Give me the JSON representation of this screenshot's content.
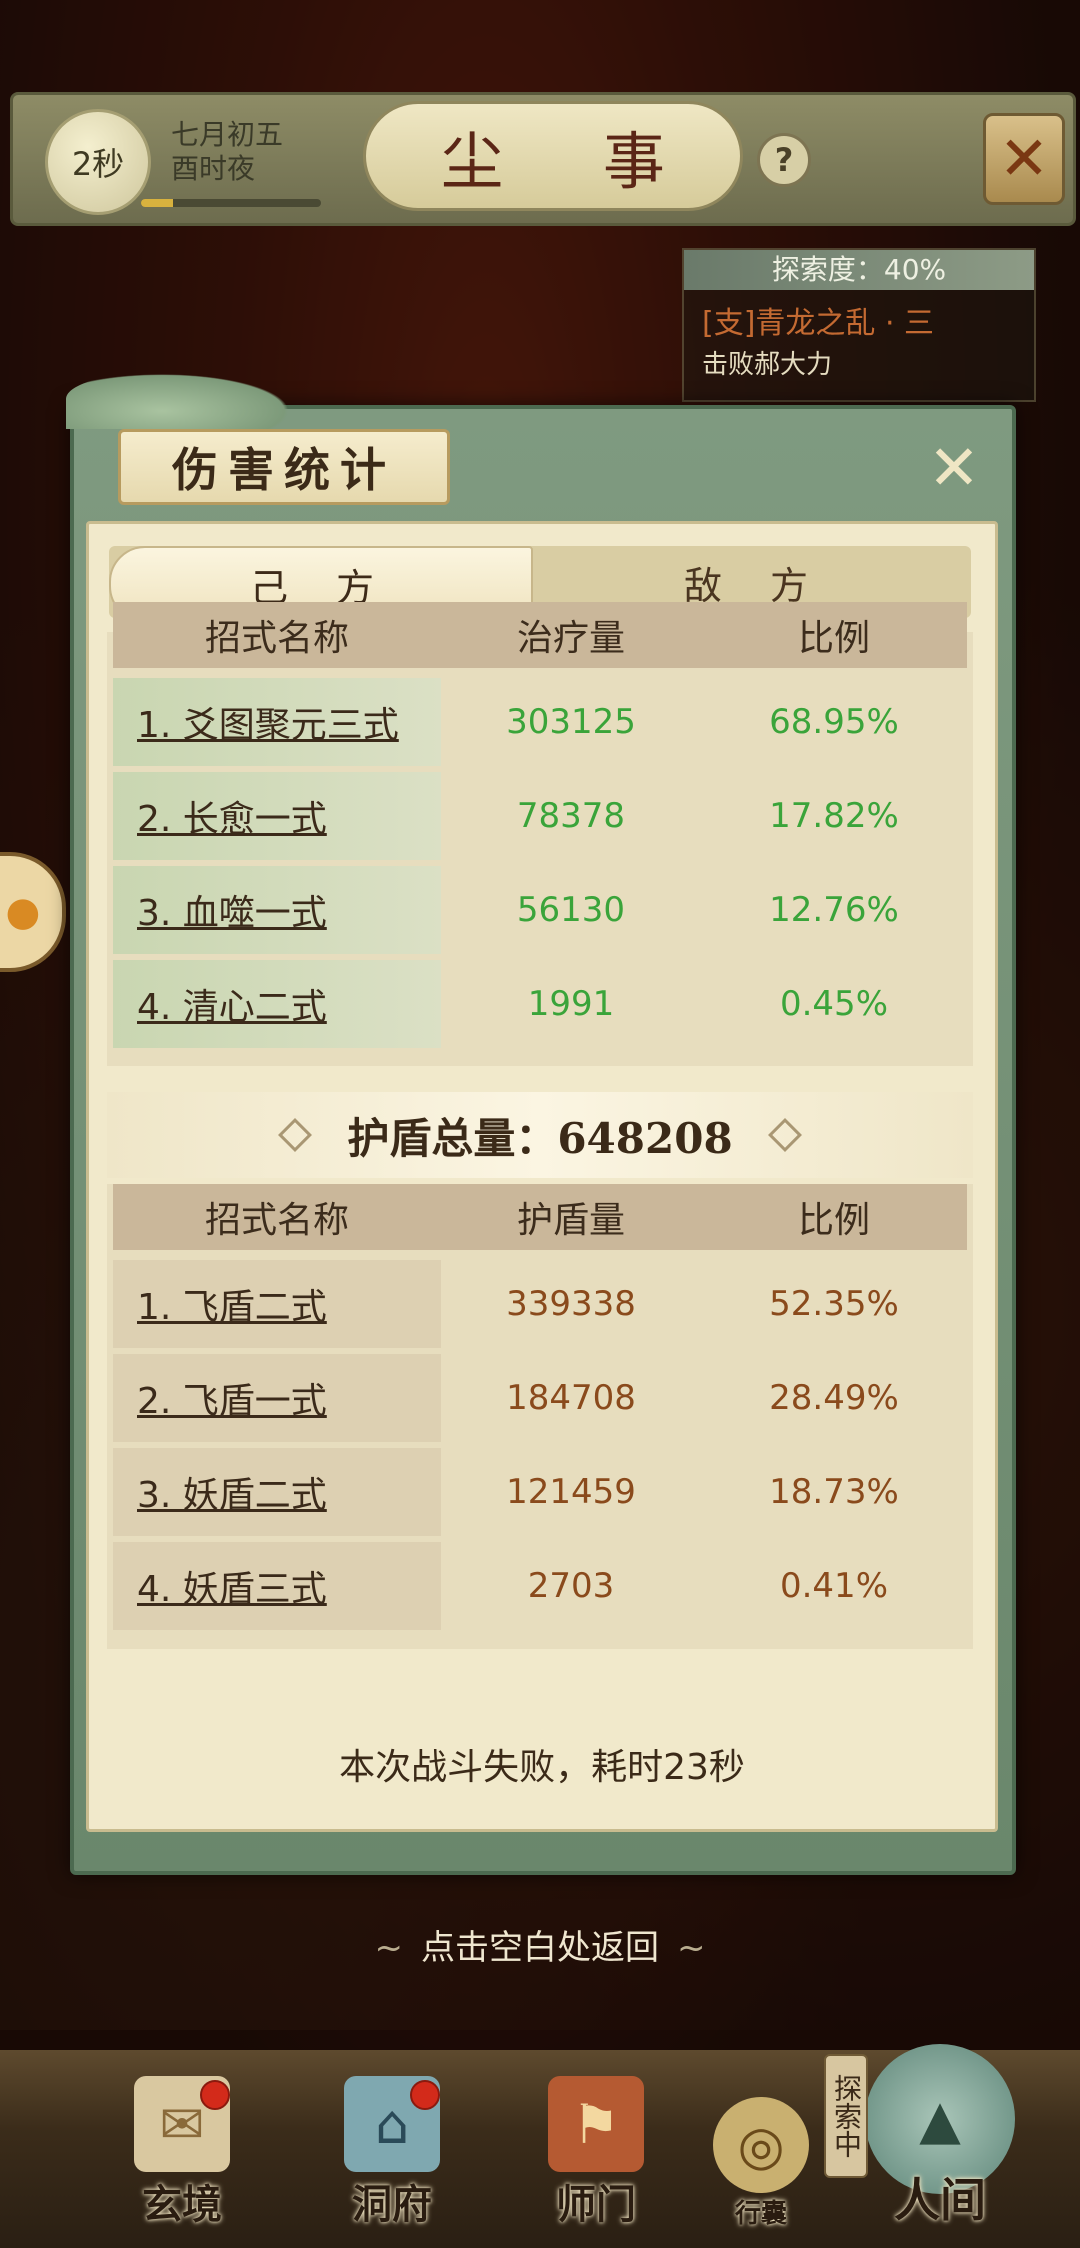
{
  "topbar": {
    "timer": "2秒",
    "date_line1": "七月初五",
    "date_line2": "酉时夜",
    "time_progress": 0.18,
    "title": "尘 事",
    "help_icon": "?",
    "close_icon": "✕"
  },
  "quest": {
    "progress_label": "探索度：40%",
    "title": "[支]青龙之乱 · 三",
    "desc": "击败郝大力"
  },
  "dialog": {
    "title": "伤害统计",
    "close_icon": "✕",
    "tabs": [
      {
        "label": "己 方"
      },
      {
        "label": "敌 方"
      }
    ],
    "healing": {
      "headers": [
        "招式名称",
        "治疗量",
        "比例"
      ],
      "rows": [
        {
          "name": "1. 爻图聚元三式",
          "amount": "303125",
          "ratio": "68.95%"
        },
        {
          "name": "2. 长愈一式",
          "amount": "78378",
          "ratio": "17.82%"
        },
        {
          "name": "3. 血噬一式",
          "amount": "56130",
          "ratio": "12.76%"
        },
        {
          "name": "4. 清心二式",
          "amount": "1991",
          "ratio": "0.45%"
        }
      ]
    },
    "shield_total_label": "护盾总量：648208",
    "shield": {
      "headers": [
        "招式名称",
        "护盾量",
        "比例"
      ],
      "rows": [
        {
          "name": "1. 飞盾二式",
          "amount": "339338",
          "ratio": "52.35%"
        },
        {
          "name": "2. 飞盾一式",
          "amount": "184708",
          "ratio": "28.49%"
        },
        {
          "name": "3. 妖盾二式",
          "amount": "121459",
          "ratio": "18.73%"
        },
        {
          "name": "4. 妖盾三式",
          "amount": "2703",
          "ratio": "0.41%"
        }
      ]
    },
    "result": "本次战斗失败，耗时23秒"
  },
  "return_hint": "点击空白处返回",
  "nav": [
    {
      "label": "玄境",
      "icon": "scroll-icon"
    },
    {
      "label": "洞府",
      "icon": "pavilion-icon"
    },
    {
      "label": "师门",
      "icon": "banner-icon"
    },
    {
      "label": "行囊",
      "icon": "bag-icon"
    },
    {
      "label": "人间",
      "icon": "landscape-icon"
    }
  ],
  "explore_tag": "探索中",
  "colors": {
    "heal_value": "#3aa43a",
    "shield_value": "#8a4a1c",
    "title_red": "#5b2616"
  }
}
